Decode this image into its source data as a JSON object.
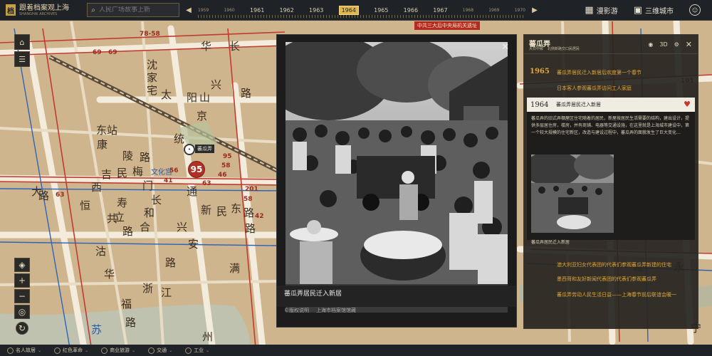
{
  "app": {
    "logo_title": "跟着档案观上海",
    "logo_subtitle": "SHANGHAI ARCHIVES",
    "search_placeholder": "人民广场故事上新",
    "nav_button_1": "漫影游",
    "nav_button_2": "三维城市",
    "user_icon": "user-icon"
  },
  "timeline": {
    "years": [
      "1959",
      "1960",
      "1961",
      "1962",
      "1963",
      "1964",
      "1965",
      "1966",
      "1967",
      "1968",
      "1969",
      "1970"
    ],
    "selected": "1964"
  },
  "map": {
    "labels": [
      "华",
      "长",
      "沈",
      "家",
      "宅",
      "太",
      "阳",
      "山",
      "兴",
      "路",
      "东站",
      "京",
      "康",
      "陵",
      "路",
      "统",
      "吉",
      "民",
      "梅",
      "文化宫",
      "西",
      "门",
      "恒",
      "路",
      "寿",
      "立",
      "大",
      "通",
      "和",
      "长",
      "新",
      "民",
      "东",
      "路",
      "共",
      "路",
      "合",
      "兴",
      "路",
      "沽",
      "路",
      "安",
      "满",
      "华",
      "苏",
      "州",
      "浙",
      "福",
      "江",
      "路",
      "东",
      "路",
      "安",
      "苏",
      "永",
      "城",
      "溪",
      "宁"
    ],
    "route_numbers": [
      "78-58",
      "69",
      "69",
      "63",
      "41",
      "63",
      "95",
      "58",
      "46",
      "201",
      "58",
      "56",
      "42",
      "101"
    ],
    "marker_label": "蕃瓜弄",
    "marker_number": "95",
    "banner": "中共三大后中央局机关遗址"
  },
  "photo": {
    "caption": "蕃瓜弄居民迁入新居",
    "copyright_label": "©版权说明",
    "copyright_holder": "上海市档案馆馆藏"
  },
  "panel": {
    "title": "蕃瓜弄",
    "sub_1": "大日中致",
    "sub_2": "北侧新路交口民居民",
    "icon_3d": "3D",
    "events_top": [
      {
        "year": "1965",
        "text": "蕃瓜弄居民迁入新居后欢度第一个春节"
      },
      {
        "year": "",
        "text": "日本客人参观蕃瓜弄访问工人家庭"
      }
    ],
    "card": {
      "year": "1964",
      "title": "蕃瓜弄居民迁入新居",
      "body": "蕃瓜弄的旧式弄棚屋区住宅随着的居民，新屋按居民生活需要的结构，建出设计，提供多层居住房，楼房，并有商铺、电器等交通设施，在这里就是上海城市建设中，第一个较大规模的住宅新区，改造与建设过程中，蕃瓜弄的面貌发生了巨大变化…",
      "thumb_caption": "蕃瓜弄居民迁入新居"
    },
    "events_bottom": [
      "澳大利亚妇女代表团的代表们参观蕃瓜弄新建的住宅",
      "墨西哥和友好新闻代表团的代表们参观蕃瓜弄",
      "蕃瓜弄劳动人民生活日益——上海春节前后联谊会暖一"
    ]
  },
  "bottom": {
    "items": [
      "名人故居",
      "红色革命",
      "商业旅游",
      "交通",
      "工业"
    ]
  }
}
